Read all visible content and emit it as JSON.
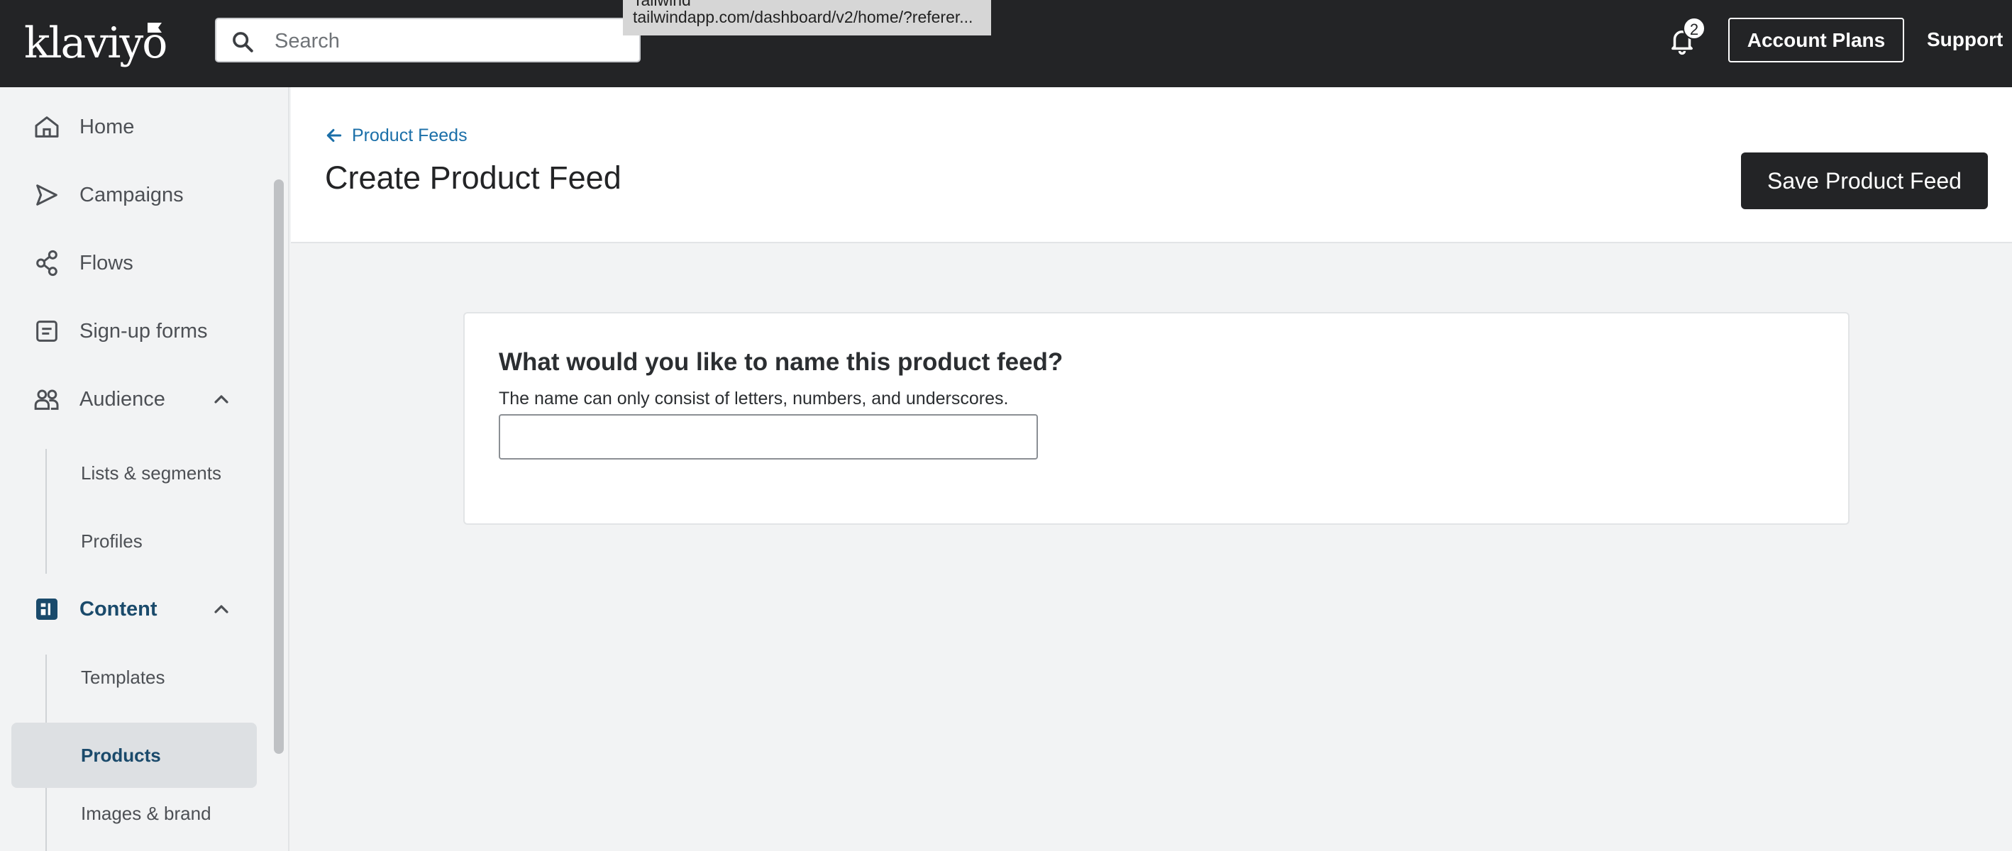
{
  "topbar": {
    "logo": "klaviyo",
    "search_placeholder": "Search",
    "tooltip_title": "Tailwind",
    "tooltip_url": "tailwindapp.com/dashboard/v2/home/?referer...",
    "notification_count": "2",
    "account_plans_label": "Account Plans",
    "support_label": "Support"
  },
  "sidebar": {
    "items": [
      {
        "label": "Home",
        "icon": "home-icon"
      },
      {
        "label": "Campaigns",
        "icon": "send-icon"
      },
      {
        "label": "Flows",
        "icon": "flows-icon"
      },
      {
        "label": "Sign-up forms",
        "icon": "form-icon"
      },
      {
        "label": "Audience",
        "icon": "audience-icon",
        "expanded": true
      },
      {
        "label": "Content",
        "icon": "content-icon",
        "expanded": true,
        "active": true
      }
    ],
    "audience_sub": [
      "Lists & segments",
      "Profiles"
    ],
    "content_sub": [
      "Templates",
      "Products",
      "Images & brand"
    ],
    "active_sub": "Products"
  },
  "header": {
    "back_label": "Product Feeds",
    "title": "Create Product Feed",
    "save_label": "Save Product Feed"
  },
  "card": {
    "heading": "What would you like to name this product feed?",
    "help": "The name can only consist of letters, numbers, and underscores.",
    "input_value": ""
  },
  "colors": {
    "topbar_bg": "#232426",
    "link_blue": "#1b6fa8",
    "active_nav": "#1a4a6b"
  }
}
